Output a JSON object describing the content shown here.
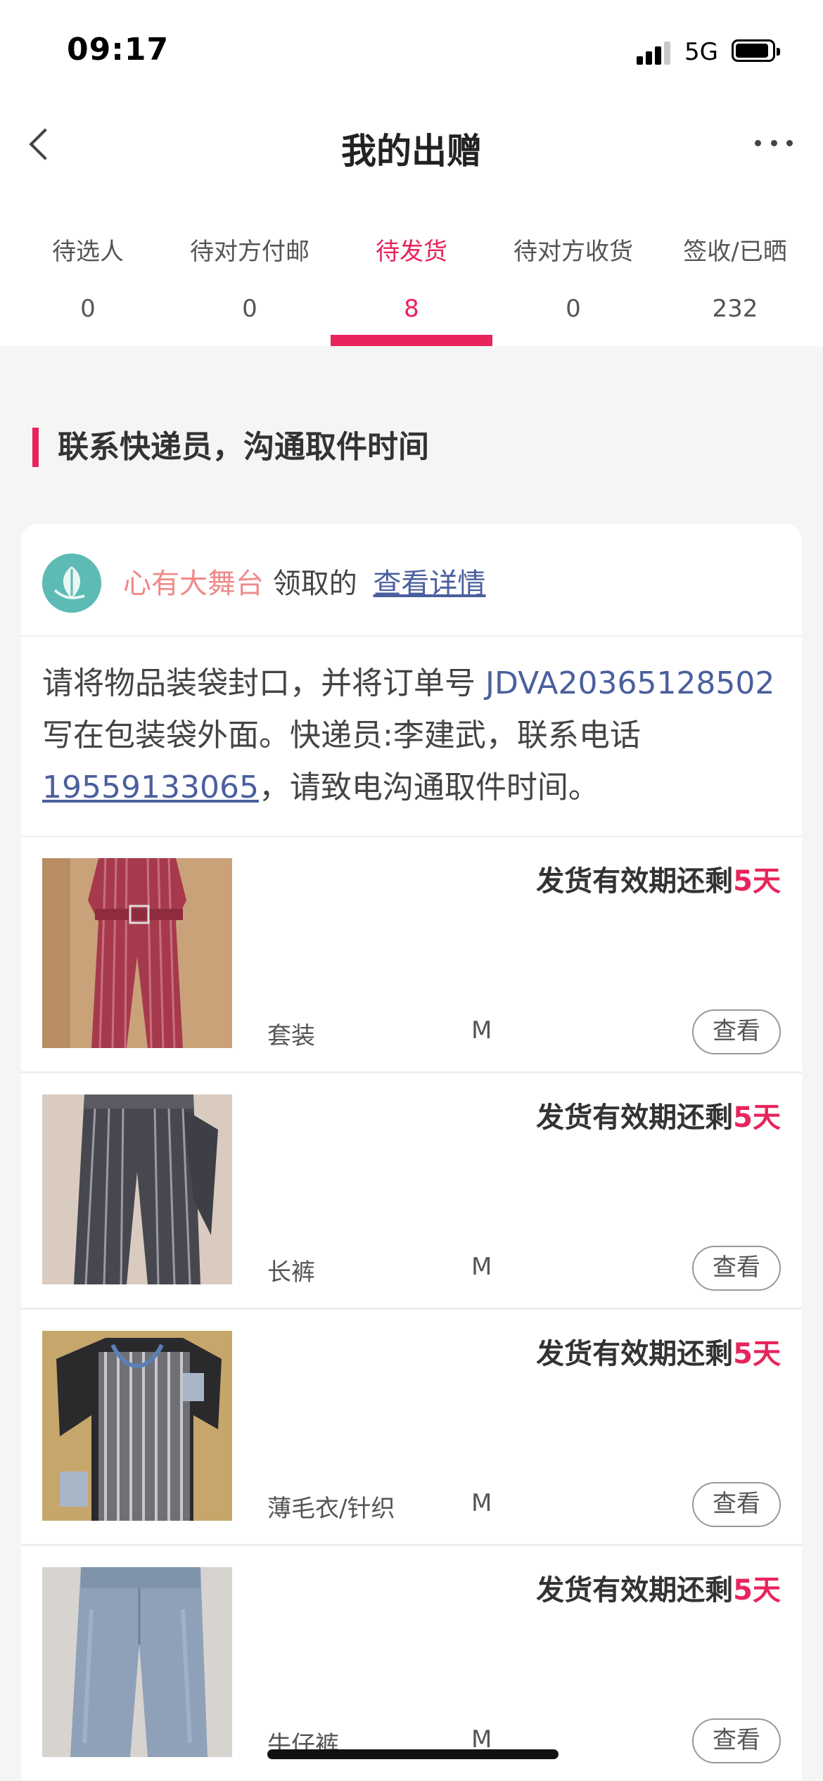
{
  "status_bar": {
    "time": "09:17",
    "network": "5G"
  },
  "header": {
    "title": "我的出赠"
  },
  "tabs": [
    {
      "label": "待选人",
      "count": "0"
    },
    {
      "label": "待对方付邮",
      "count": "0"
    },
    {
      "label": "待发货",
      "count": "8"
    },
    {
      "label": "待对方收货",
      "count": "0"
    },
    {
      "label": "签收/已晒",
      "count": "232"
    }
  ],
  "section": {
    "heading": "联系快递员，沟通取件时间"
  },
  "donor": {
    "name": "心有大舞台",
    "action": "领取的",
    "link": "查看详情"
  },
  "instructions": {
    "part1": "请将物品装袋封口，并将订单号 ",
    "order_number": "JDVA20365128502",
    "part2": " 写在包装袋外面。快递员:李建武，联系电话",
    "phone": "19559133065",
    "part3": "，请致电沟通取件时间。"
  },
  "items": [
    {
      "deadline_prefix": "发货有效期还剩",
      "deadline_days": "5天",
      "category": "套装",
      "size": "M",
      "view_label": "查看"
    },
    {
      "deadline_prefix": "发货有效期还剩",
      "deadline_days": "5天",
      "category": "长裤",
      "size": "M",
      "view_label": "查看"
    },
    {
      "deadline_prefix": "发货有效期还剩",
      "deadline_days": "5天",
      "category": "薄毛衣/针织",
      "size": "M",
      "view_label": "查看"
    },
    {
      "deadline_prefix": "发货有效期还剩",
      "deadline_days": "5天",
      "category": "牛仔裤",
      "size": "M",
      "view_label": "查看"
    }
  ],
  "colors": {
    "accent": "#e8245c",
    "link": "#4b5f9e",
    "donor_name": "#ef8a8a"
  }
}
